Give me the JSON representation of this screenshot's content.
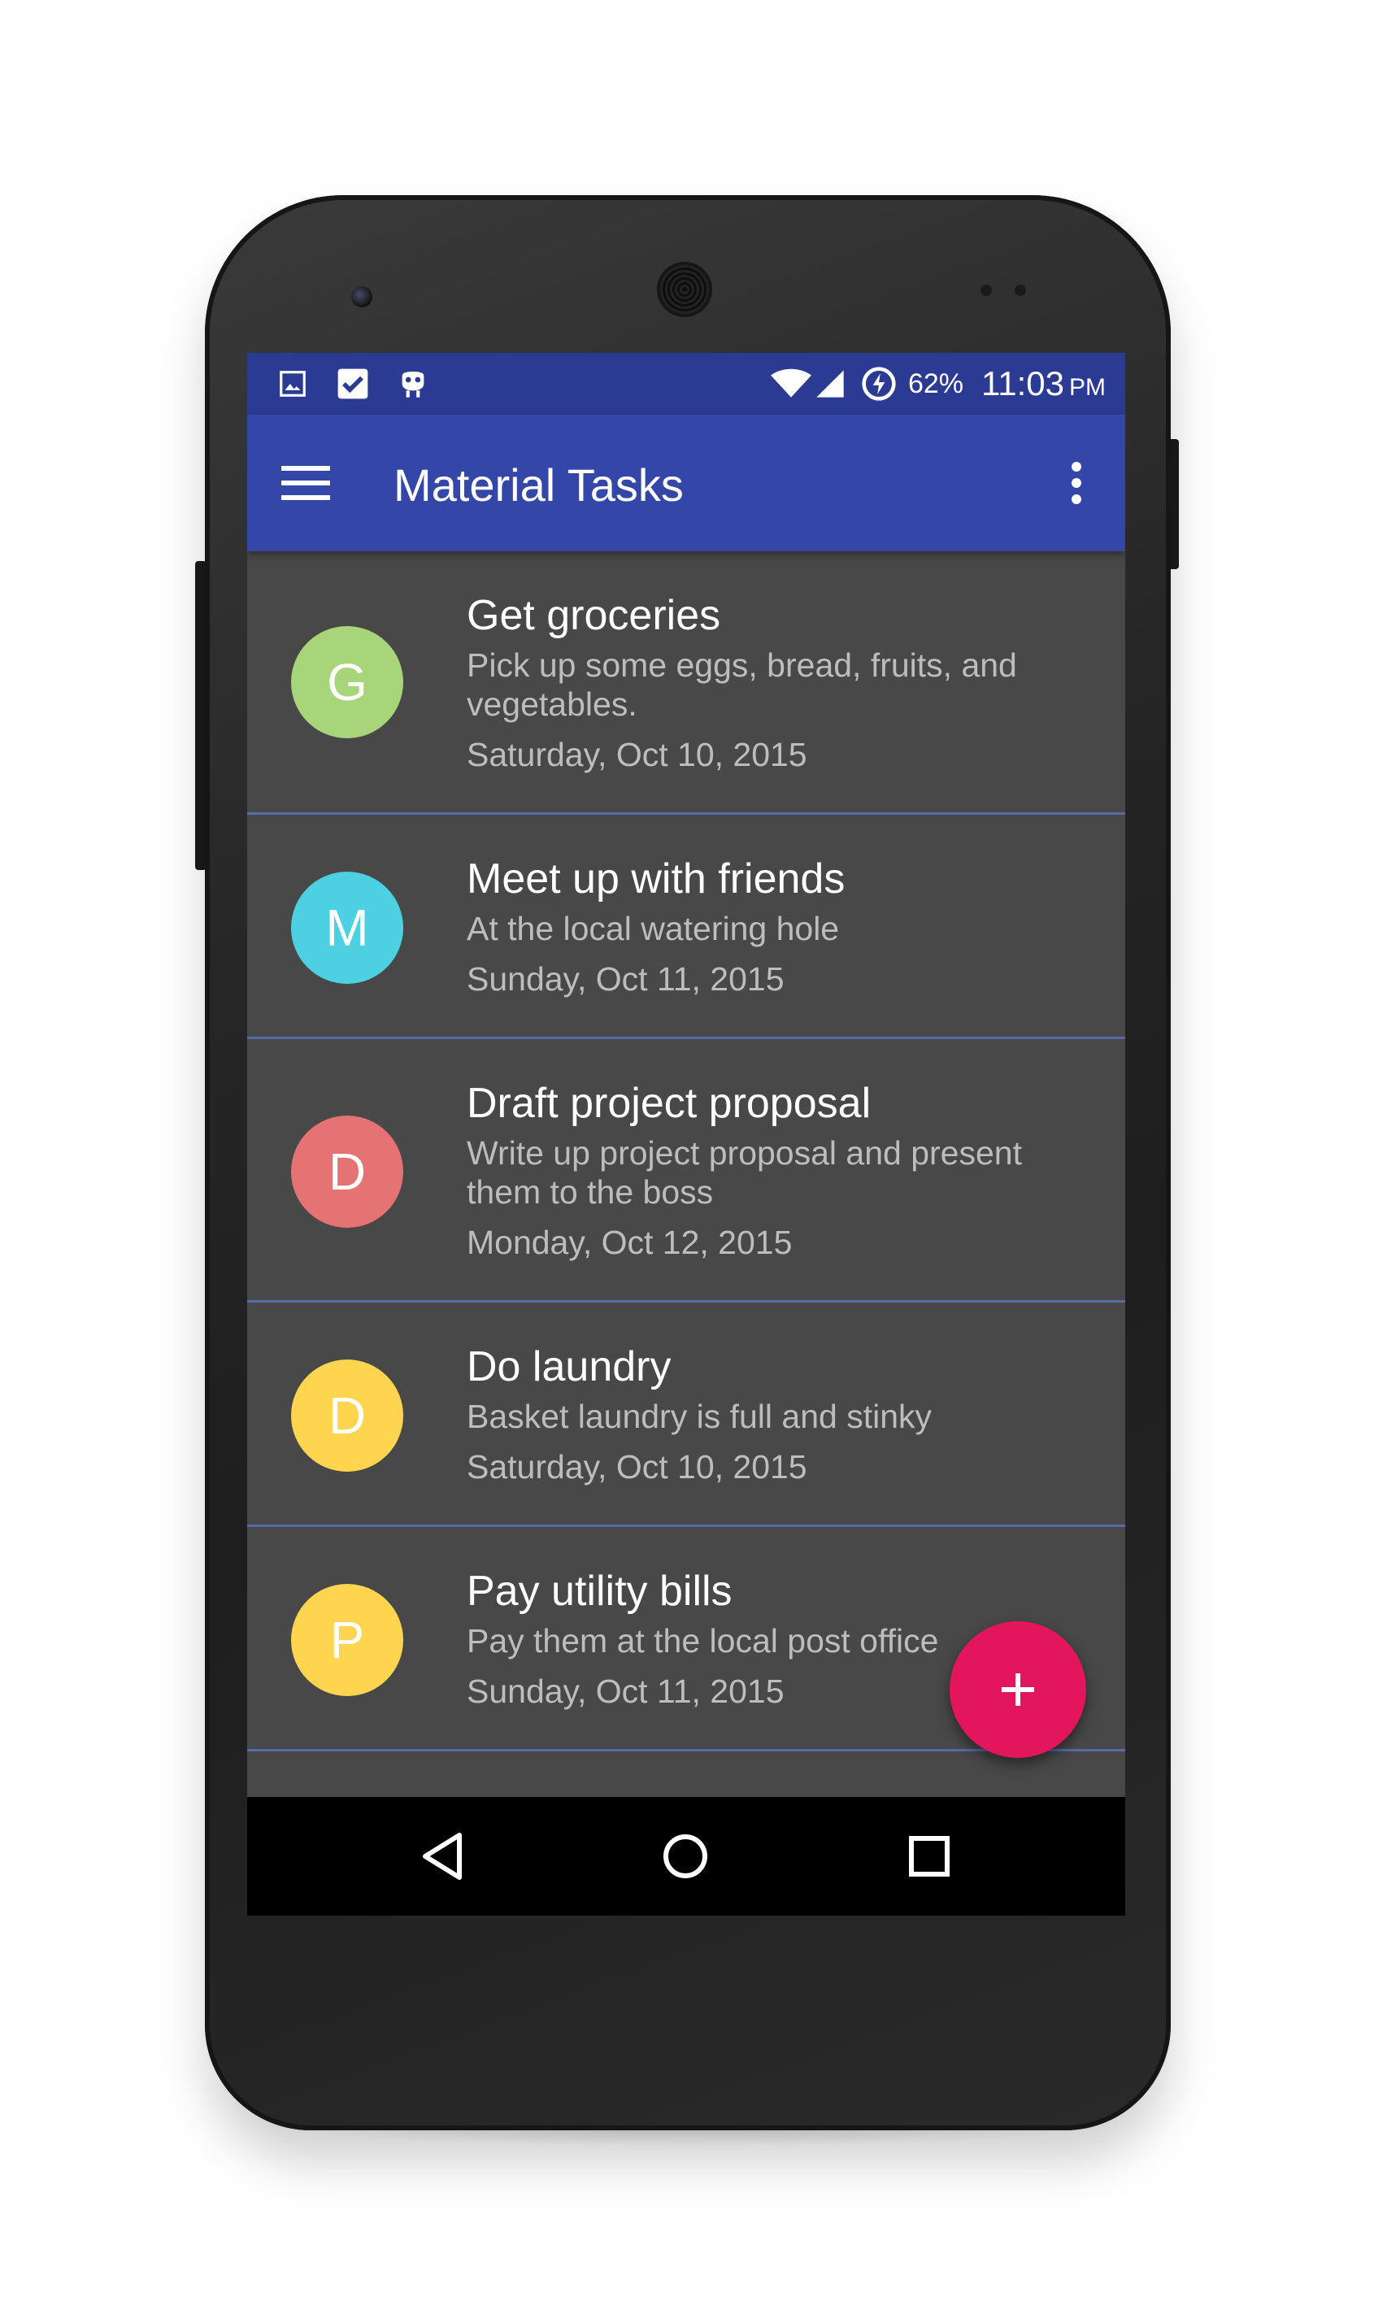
{
  "status_bar": {
    "icons_left": [
      "image-icon",
      "check-box-icon",
      "cyanogen-icon"
    ],
    "icons_right": [
      "wifi-icon",
      "signal-icon",
      "battery-charging-icon"
    ],
    "battery": "62%",
    "time": "11:03",
    "ampm": "PM"
  },
  "app_bar": {
    "title": "Material Tasks",
    "menu_icon": "hamburger-menu-icon",
    "overflow_icon": "more-vert-icon"
  },
  "tasks": [
    {
      "initial": "G",
      "title": "Get groceries",
      "description": "Pick up some eggs, bread, fruits, and vegetables.",
      "date": "Saturday, Oct 10, 2015",
      "color": "#a9d57a"
    },
    {
      "initial": "M",
      "title": "Meet up with friends",
      "description": "At the local watering hole",
      "date": "Sunday, Oct 11, 2015",
      "color": "#4dd0e1"
    },
    {
      "initial": "D",
      "title": "Draft project proposal",
      "description": "Write up project proposal and present them to the boss",
      "date": "Monday, Oct 12, 2015",
      "color": "#e57373"
    },
    {
      "initial": "D",
      "title": "Do laundry",
      "description": "Basket laundry is full and stinky",
      "date": "Saturday, Oct 10, 2015",
      "color": "#ffd54f"
    },
    {
      "initial": "P",
      "title": "Pay utility bills",
      "description": "Pay them at the local post office",
      "date": "Sunday, Oct 11, 2015",
      "color": "#ffd54f"
    }
  ],
  "fab": {
    "icon": "add-icon",
    "label": "+",
    "color": "#e3165d"
  },
  "nav_bar": {
    "icons": [
      "back-icon",
      "home-icon",
      "recent-apps-icon"
    ]
  },
  "colors": {
    "status_bar": "#2b3a92",
    "app_bar": "#3446a8",
    "list_bg": "#484848"
  }
}
